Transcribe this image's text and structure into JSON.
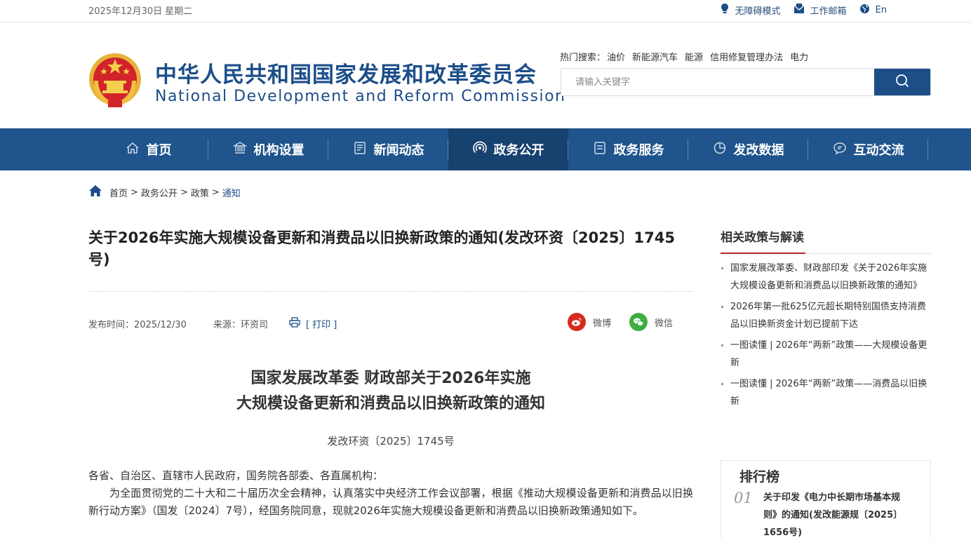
{
  "topbar": {
    "date": "2025年12月30日 星期二",
    "tools": [
      {
        "label": "无障碍模式",
        "icon": "accessibility-icon"
      },
      {
        "label": "工作邮箱",
        "icon": "mail-icon"
      },
      {
        "label": "En",
        "icon": "globe-icon"
      }
    ]
  },
  "header": {
    "site_name_cn": "中华人民共和国国家发展和改革委员会",
    "site_name_en": "National Development and Reform Commission",
    "hot_label": "热门搜索：",
    "hot_items": [
      "油价",
      "新能源汽车",
      "能源",
      "信用修复管理办法",
      "电力"
    ],
    "search_placeholder": "请输入关键字"
  },
  "nav": {
    "items": [
      {
        "label": "首页",
        "icon": "home-icon"
      },
      {
        "label": "机构设置",
        "icon": "institution-icon"
      },
      {
        "label": "新闻动态",
        "icon": "news-icon"
      },
      {
        "label": "政务公开",
        "icon": "broadcast-icon",
        "active": true
      },
      {
        "label": "政务服务",
        "icon": "service-icon"
      },
      {
        "label": "发改数据",
        "icon": "pie-chart-icon"
      },
      {
        "label": "互动交流",
        "icon": "chat-icon"
      }
    ]
  },
  "breadcrumb": {
    "items": [
      "首页",
      "政务公开",
      "政策"
    ],
    "separator": ">",
    "current": "通知"
  },
  "article": {
    "title": "关于2026年实施大规模设备更新和消费品以旧换新政策的通知(发改环资〔2025〕1745号)",
    "publish_time": "发布时间：2025/12/30",
    "source": "来源：环资司",
    "print_label": "[ 打印 ]",
    "share": [
      {
        "label": "微博",
        "icon": "weibo-icon",
        "color": "#d52b1e"
      },
      {
        "label": "微信",
        "icon": "wechat-icon",
        "color": "#3dae3f"
      }
    ],
    "doc_title_line1": "国家发展改革委 财政部关于2026年实施",
    "doc_title_line2": "大规模设备更新和消费品以旧换新政策的通知",
    "doc_number": "发改环资〔2025〕1745号",
    "salutation": "各省、自治区、直辖市人民政府，国务院各部委、各直属机构：",
    "paragraph1": "为全面贯彻党的二十大和二十届历次全会精神，认真落实中央经济工作会议部署，根据《推动大规模设备更新和消费品以旧换新行动方案》（国发〔2024〕7号），经国务院同意，现就2026年实施大规模设备更新和消费品以旧换新政策通知如下。"
  },
  "sidebar": {
    "related_title": "相关政策与解读",
    "related": [
      "国家发展改革委、财政部印发《关于2026年实施大规模设备更新和消费品以旧换新政策的通知》",
      "2026年第一批625亿元超长期特别国债支持消费品以旧换新资金计划已提前下达",
      "一图读懂 | 2026年“两新”政策——大规模设备更新",
      "一图读懂 | 2026年“两新”政策——消费品以旧换新"
    ],
    "rank_title": "排行榜",
    "rank": [
      {
        "no": "01",
        "text": "关于印发《电力中长期市场基本规则》的通知(发改能源规〔2025〕1656号)"
      }
    ]
  }
}
